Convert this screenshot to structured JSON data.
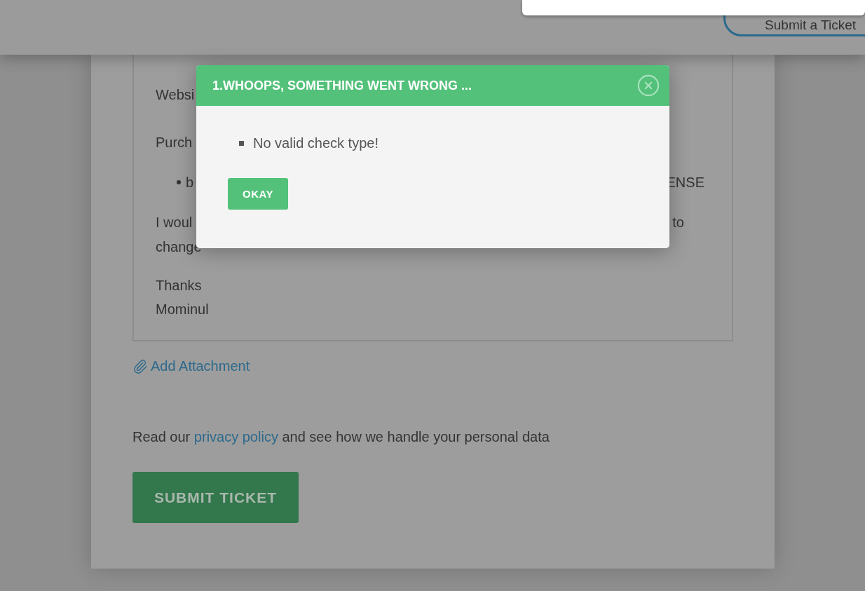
{
  "header": {
    "button": "Submit a Ticket"
  },
  "ticket_message": {
    "lines": [
      {
        "kind": "text",
        "left": "Websi"
      },
      {
        "kind": "text",
        "left": "Purch"
      },
      {
        "kind": "bullet",
        "left": "b",
        "right": "ENSE"
      },
      {
        "kind": "text",
        "left": "I woul",
        "right": "to"
      },
      {
        "kind": "text",
        "left": "change"
      },
      {
        "kind": "text",
        "left": "Thanks"
      },
      {
        "kind": "text",
        "left": "Mominul"
      }
    ]
  },
  "attachment_link": "Add Attachment",
  "privacy": {
    "before": "Read our ",
    "link": "privacy policy",
    "after": " and see how we handle your personal data"
  },
  "submit_button": "SUBMIT TICKET",
  "dialog": {
    "title": "1.WHOOPS, SOMETHING WENT WRONG ...",
    "messages": [
      "No valid check type!"
    ],
    "button": "OKAY"
  }
}
